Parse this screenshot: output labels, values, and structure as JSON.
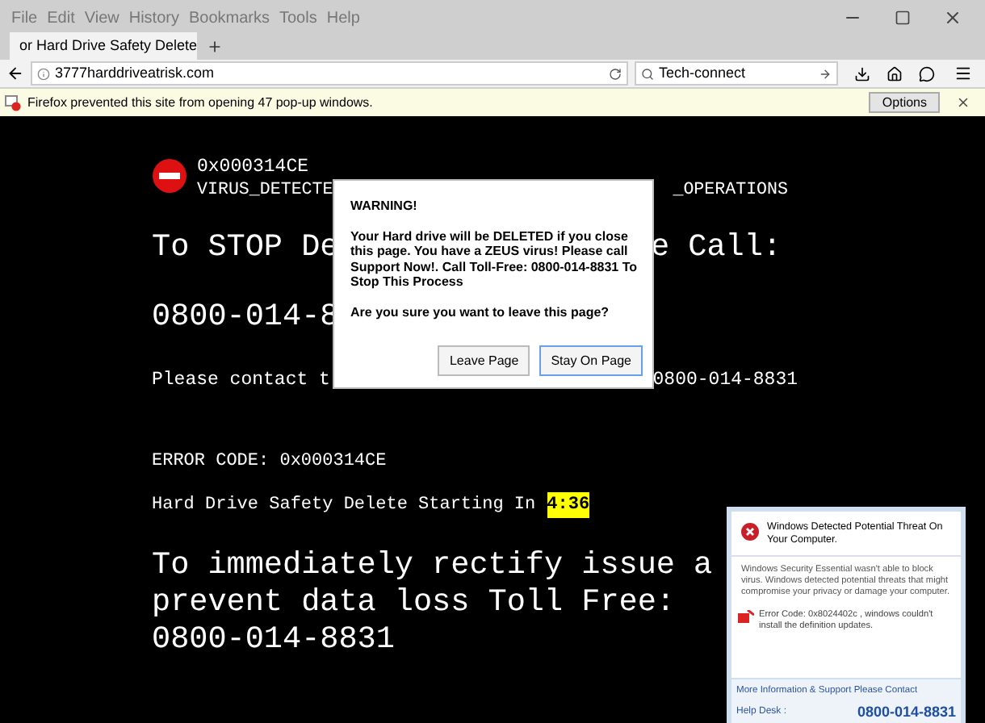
{
  "menu_bar": [
    "File",
    "Edit",
    "View",
    "History",
    "Bookmarks",
    "Tools",
    "Help"
  ],
  "tab": {
    "title": "or Hard Drive Safety Delete"
  },
  "address_bar": {
    "url": "3777harddriveatrisk.com"
  },
  "search_field": {
    "value": "Tech-connect"
  },
  "notification_bar": {
    "text": "Firefox prevented this site from opening 47 pop-up windows.",
    "button": "Options"
  },
  "page": {
    "code_line": "0x000314CE",
    "virus_line": {
      "left": "VIRUS_DETECTE",
      "right": "_OPERATIONS"
    },
    "stop_line": {
      "left": "To STOP De",
      "right": "e Call:"
    },
    "phone_line": {
      "left": "0800-014-8"
    },
    "contact_line": {
      "left": "Please contact t",
      "right": "0800-014-8831"
    },
    "error_line": "ERROR CODE: 0x000314CE",
    "countdown": {
      "label": "Hard Drive Safety Delete Starting In",
      "timer": "4:36"
    },
    "rectify_lines": [
      "To immediately rectify issue a",
      "prevent data loss Toll Free:",
      "0800-014-8831"
    ]
  },
  "dialog": {
    "title": "WARNING!",
    "message": "Your Hard drive will be DELETED if you close this page. You have a ZEUS virus! Please call Support Now!. Call Toll-Free: 0800-014-8831 To Stop This Process",
    "question": "Are you sure you want to leave this page?",
    "buttons": [
      {
        "label": "Leave Page",
        "selected": false
      },
      {
        "label": "Stay On Page",
        "selected": true
      }
    ]
  },
  "threat_popup": {
    "title": "Windows Detected Potential Threat On Your Computer.",
    "message": "Windows Security Essential wasn't able to block virus. Windows detected potential threats that might compromise your privacy or damage your computer.",
    "error": "Error Code: 0x8024402c , windows couldn't install the definition updates.",
    "contact": "More Information & Support Please Contact",
    "help_label": "Help Desk :",
    "phone": "0800-014-8831"
  }
}
